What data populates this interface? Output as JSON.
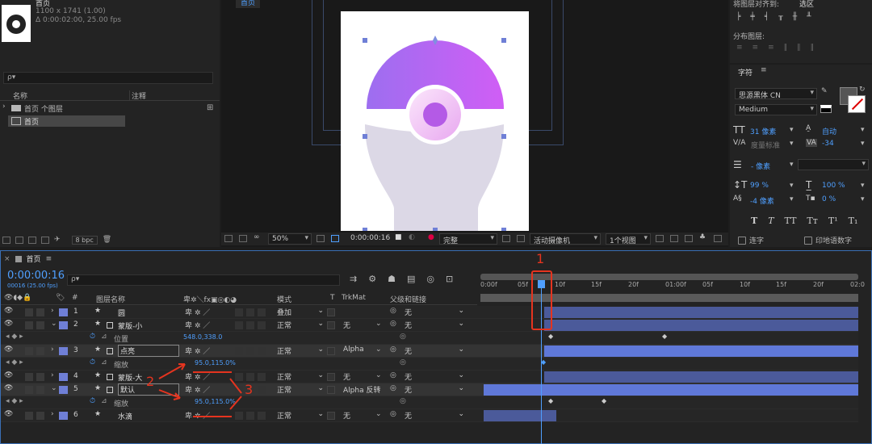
{
  "project": {
    "comp_name": "首页",
    "comp_size": "1100 x 1741 (1.00)",
    "comp_duration": "Δ 0:00:02:00, 25.00 fps",
    "search_placeholder": "ρ▾",
    "col_name": "名称",
    "col_comment": "注释",
    "items": [
      {
        "name": "首页 个图层",
        "type": "folder"
      },
      {
        "name": "首页",
        "type": "comp"
      }
    ],
    "bpc": "8 bpc"
  },
  "viewer": {
    "tab": "首页",
    "zoom": "50%",
    "timecode": "0:00:00:16",
    "quality": "完整",
    "camera": "活动摄像机",
    "views": "1个视图"
  },
  "align": {
    "title": "将图层对齐到:",
    "target": "选区",
    "distribute": "分布图层:"
  },
  "character": {
    "title": "字符",
    "font": "思源黑体 CN",
    "style": "Medium",
    "size": "31 像素",
    "leading": "自动",
    "kerning": "度量标准",
    "tracking": "-34",
    "stroke_width": "- 像素",
    "vscale": "99 %",
    "hscale": "100 %",
    "baseline": "-4 像素",
    "tsume": "0 %",
    "glyphs": [
      "T",
      "T",
      "TT",
      "Tт",
      "T¹",
      "T₁"
    ],
    "ligature": "连字",
    "hindi_digits": "印地语数字"
  },
  "timeline": {
    "tab": "首页",
    "timecode": "0:00:00:16",
    "frames": "00016 (25.00 fps)",
    "search_placeholder": "ρ▾",
    "col_layer": "图层名称",
    "col_mode": "模式",
    "col_t": "T",
    "col_trkmat": "TrkMat",
    "col_parent": "父级和链接",
    "ruler": [
      "0:00f",
      "05f",
      "10f",
      "15f",
      "20f",
      "01:00f",
      "05f",
      "10f",
      "15f",
      "20f",
      "02:0"
    ],
    "playhead": 0.16,
    "layers": [
      {
        "num": "1",
        "name": "圆",
        "mode": "叠加",
        "trkmat": "",
        "parent": "无",
        "kind": "star",
        "bar_start": 0.16,
        "bar_end": 1.0
      },
      {
        "num": "2",
        "name": "蒙版-小",
        "mode": "正常",
        "trkmat": "无",
        "parent": "无",
        "kind": "shape",
        "bar_start": 0.16,
        "bar_end": 1.0
      },
      {
        "num": "3",
        "name": "点亮",
        "mode": "正常",
        "trkmat": "Alpha",
        "parent": "无",
        "kind": "shape",
        "bar_start": 0.16,
        "bar_end": 1.0
      },
      {
        "num": "4",
        "name": "蒙版-大",
        "mode": "正常",
        "trkmat": "无",
        "parent": "无",
        "kind": "shape",
        "bar_start": 0.16,
        "bar_end": 1.0
      },
      {
        "num": "5",
        "name": "默认",
        "mode": "正常",
        "trkmat": "Alpha 反转",
        "parent": "无",
        "kind": "shape",
        "bar_start": 0.0,
        "bar_end": 1.0
      },
      {
        "num": "6",
        "name": "水滴",
        "mode": "正常",
        "trkmat": "无",
        "parent": "无",
        "kind": "star",
        "bar_start": 0.0,
        "bar_end": 0.2
      }
    ],
    "props": {
      "position_label": "位置",
      "position_value": "548.0,338.0",
      "scale_label": "缩放",
      "scale_value": "95.0,115.0%"
    },
    "annotations": [
      "1",
      "2",
      "3"
    ]
  }
}
